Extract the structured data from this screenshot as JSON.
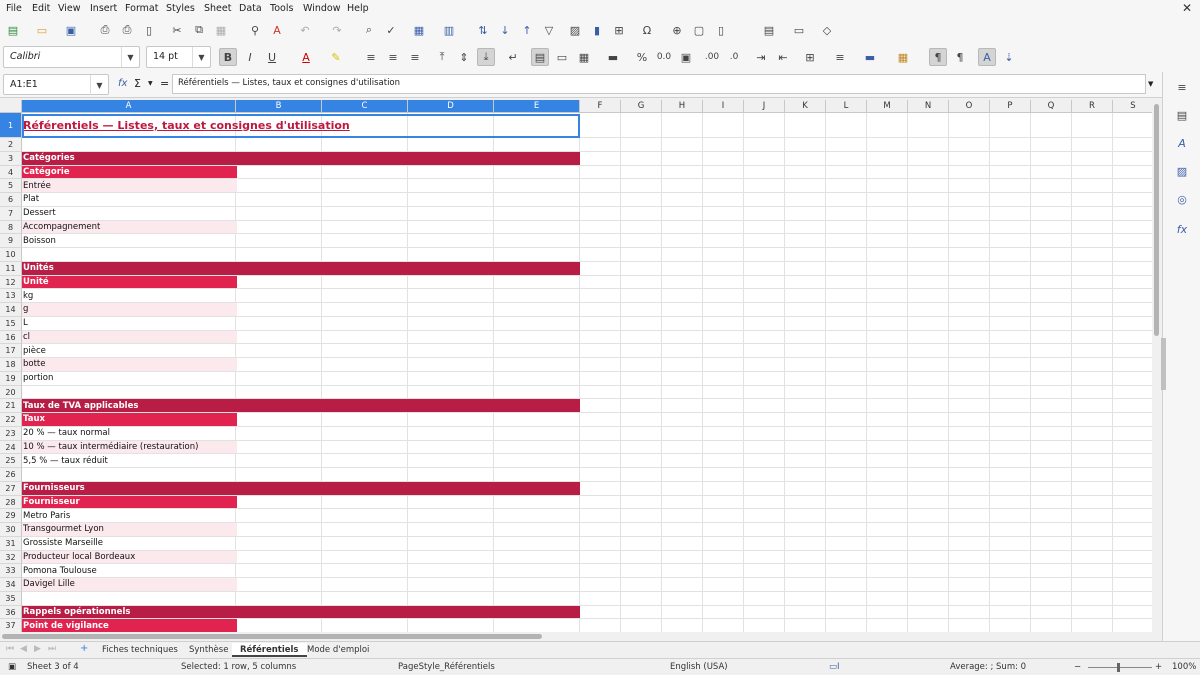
{
  "menu": [
    "File",
    "Edit",
    "View",
    "Insert",
    "Format",
    "Styles",
    "Sheet",
    "Data",
    "Tools",
    "Window",
    "Help"
  ],
  "font_name": "Calibri",
  "font_size": "14 pt",
  "name_box": "A1:E1",
  "formula": "Référentiels — Listes, taux et consignes d'utilisation",
  "columns": [
    "A",
    "B",
    "C",
    "D",
    "E",
    "F",
    "G",
    "H",
    "I",
    "J",
    "K",
    "L",
    "M",
    "N",
    "O",
    "P",
    "Q",
    "R",
    "S"
  ],
  "rows": [
    {
      "n": "1",
      "t": "title",
      "text": "Référentiels — Listes, taux et consignes d'utilisation"
    },
    {
      "n": "2",
      "t": "blank",
      "text": ""
    },
    {
      "n": "3",
      "t": "sec",
      "text": "Catégories"
    },
    {
      "n": "4",
      "t": "hdr",
      "text": "Catégorie"
    },
    {
      "n": "5",
      "t": "alt",
      "text": "Entrée"
    },
    {
      "n": "6",
      "t": "row",
      "text": "Plat"
    },
    {
      "n": "7",
      "t": "row",
      "text": "Dessert"
    },
    {
      "n": "8",
      "t": "alt",
      "text": "Accompagnement"
    },
    {
      "n": "9",
      "t": "row",
      "text": "Boisson"
    },
    {
      "n": "10",
      "t": "blank",
      "text": ""
    },
    {
      "n": "11",
      "t": "sec",
      "text": "Unités"
    },
    {
      "n": "12",
      "t": "hdr",
      "text": "Unité"
    },
    {
      "n": "13",
      "t": "row",
      "text": "kg"
    },
    {
      "n": "14",
      "t": "alt",
      "text": "g"
    },
    {
      "n": "15",
      "t": "row",
      "text": "L"
    },
    {
      "n": "16",
      "t": "alt",
      "text": "cl"
    },
    {
      "n": "17",
      "t": "row",
      "text": "pièce"
    },
    {
      "n": "18",
      "t": "alt",
      "text": "botte"
    },
    {
      "n": "19",
      "t": "row",
      "text": "portion"
    },
    {
      "n": "20",
      "t": "blank",
      "text": ""
    },
    {
      "n": "21",
      "t": "sec",
      "text": "Taux de TVA applicables"
    },
    {
      "n": "22",
      "t": "hdr",
      "text": "Taux"
    },
    {
      "n": "23",
      "t": "row",
      "text": "20 % — taux normal"
    },
    {
      "n": "24",
      "t": "alt",
      "text": "10 % — taux intermédiaire (restauration)"
    },
    {
      "n": "25",
      "t": "row",
      "text": "5,5 % — taux réduit"
    },
    {
      "n": "26",
      "t": "blank",
      "text": ""
    },
    {
      "n": "27",
      "t": "sec",
      "text": "Fournisseurs"
    },
    {
      "n": "28",
      "t": "hdr",
      "text": "Fournisseur"
    },
    {
      "n": "29",
      "t": "row",
      "text": "Metro Paris"
    },
    {
      "n": "30",
      "t": "alt",
      "text": "Transgourmet Lyon"
    },
    {
      "n": "31",
      "t": "row",
      "text": "Grossiste Marseille"
    },
    {
      "n": "32",
      "t": "alt",
      "text": "Producteur local Bordeaux"
    },
    {
      "n": "33",
      "t": "row",
      "text": "Pomona Toulouse"
    },
    {
      "n": "34",
      "t": "alt",
      "text": "Davigel Lille"
    },
    {
      "n": "35",
      "t": "blank",
      "text": ""
    },
    {
      "n": "36",
      "t": "sec",
      "text": "Rappels opérationnels"
    },
    {
      "n": "37",
      "t": "hdr",
      "text": "Point de vigilance"
    }
  ],
  "tabs": [
    "Fiches techniques",
    "Synthèse",
    "Référentiels",
    "Mode d'emploi"
  ],
  "active_tab": "Référentiels",
  "status": {
    "sheet": "Sheet 3 of 4",
    "selection": "Selected: 1 row, 5 columns",
    "pagestyle": "PageStyle_Référentiels",
    "language": "English (USA)",
    "summary": "Average: ; Sum: 0",
    "zoom": "100%"
  }
}
